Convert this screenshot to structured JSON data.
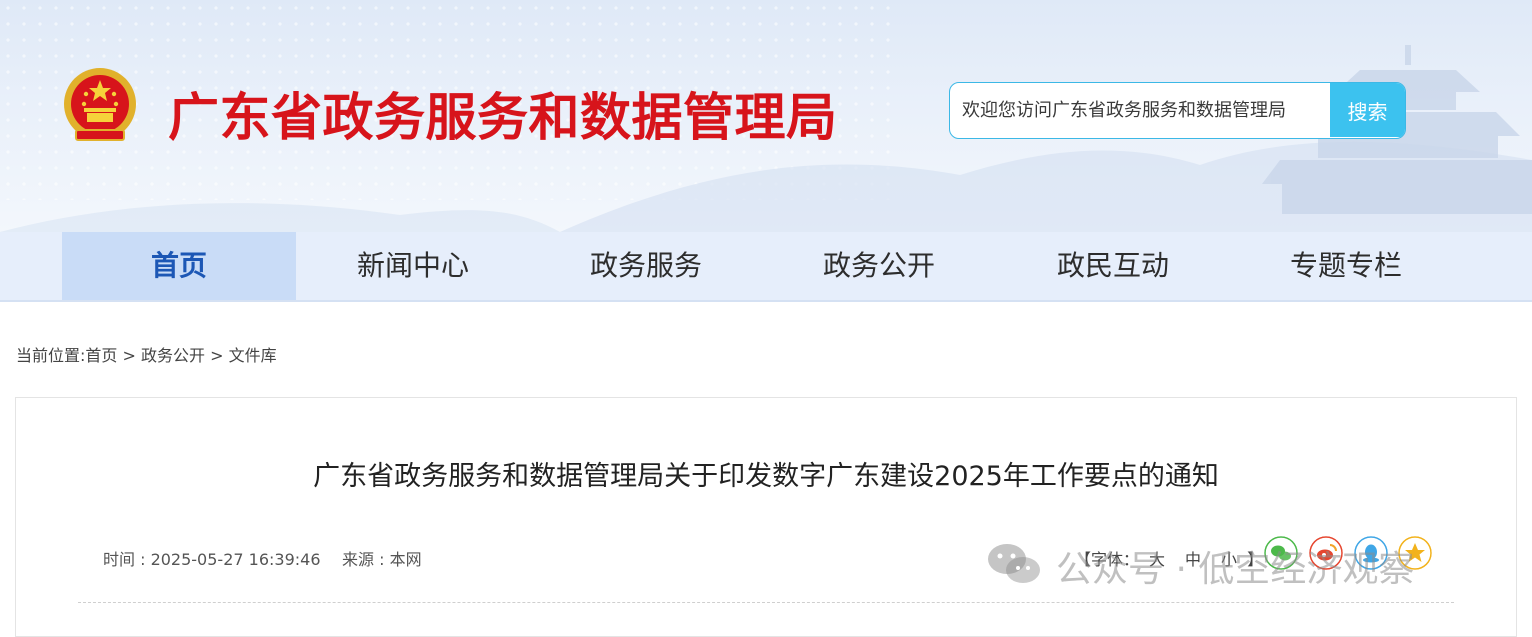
{
  "header": {
    "site_title": "广东省政务服务和数据管理局",
    "search": {
      "placeholder": "欢迎您访问广东省政务服务和数据管理局",
      "button_label": "搜索"
    }
  },
  "nav": {
    "items": [
      {
        "label": "首页",
        "active": true
      },
      {
        "label": "新闻中心",
        "active": false
      },
      {
        "label": "政务服务",
        "active": false
      },
      {
        "label": "政务公开",
        "active": false
      },
      {
        "label": "政民互动",
        "active": false
      },
      {
        "label": "专题专栏",
        "active": false
      }
    ]
  },
  "breadcrumb": {
    "prefix": "当前位置:",
    "items": [
      "首页",
      "政务公开",
      "文件库"
    ],
    "separator": " > "
  },
  "article": {
    "title": "广东省政务服务和数据管理局关于印发数字广东建设2025年工作要点的通知",
    "time_text": "时间 : 2025-05-27 16:39:46",
    "source_text": "来源 : 本网",
    "font_size_open": "【字体：",
    "font_size_options": [
      "大",
      "中",
      "小"
    ],
    "font_size_close": "】"
  },
  "share": {
    "icons": [
      "wechat-icon",
      "weibo-icon",
      "qq-icon",
      "qzone-icon"
    ]
  },
  "watermark": {
    "text": "公众号 · 低空经济观察"
  },
  "colors": {
    "title_red": "#d7141b",
    "search_blue": "#3cc2ef",
    "nav_bg": "#e6eefb",
    "nav_active_bg": "#c9dcf7",
    "nav_active_text": "#1c57b5",
    "share_wechat": "#4cb94a",
    "share_weibo": "#e6462f",
    "share_qq": "#3fa6e6",
    "share_qzone": "#f2b21b"
  }
}
